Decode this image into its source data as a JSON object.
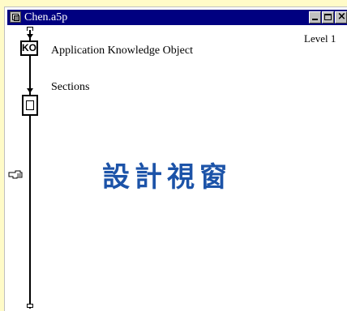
{
  "window": {
    "title": "Chen.a5p",
    "level": "Level 1"
  },
  "flowline": {
    "icons": [
      {
        "icon": "knowledge-object-icon",
        "glyph": "KO",
        "label": "Application Knowledge Object"
      },
      {
        "icon": "map-icon",
        "label": "Sections"
      }
    ]
  },
  "pointer": {
    "icon": "pointing-hand-icon"
  },
  "overlay_text": "設計視窗",
  "colors": {
    "titlebar": "#000080",
    "background": "#fffbc8",
    "overlay_text": "#1c53a8"
  }
}
